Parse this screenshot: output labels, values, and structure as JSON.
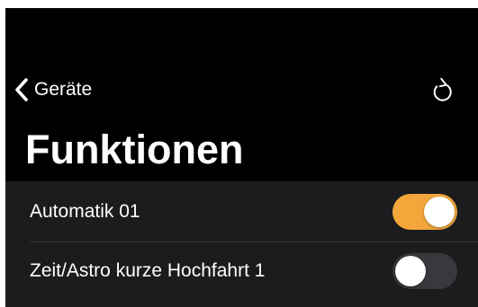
{
  "nav": {
    "back_label": "Geräte",
    "back_icon": "chevron-left-icon",
    "reload_icon": "reload-icon"
  },
  "page": {
    "title": "Funktionen"
  },
  "functions": [
    {
      "label": "Automatik 01",
      "enabled": true
    },
    {
      "label": "Zeit/Astro kurze Hochfahrt 1",
      "enabled": false
    }
  ],
  "colors": {
    "background": "#000000",
    "list_background": "#1c1c1e",
    "accent": "#f3a73b",
    "toggle_off": "#39393d",
    "text": "#ffffff"
  }
}
